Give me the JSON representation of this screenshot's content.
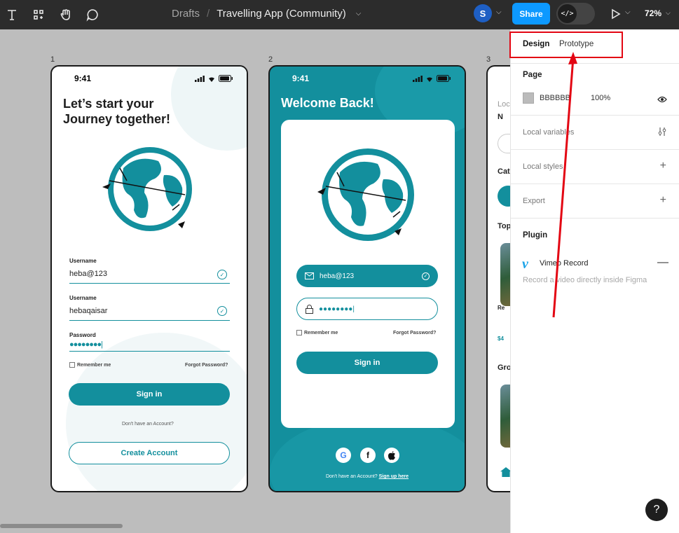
{
  "toolbar": {
    "breadcrumb": {
      "parent": "Drafts",
      "separator": "/",
      "file": "Travelling App (Community)"
    },
    "avatar_letter": "S",
    "share_label": "Share",
    "zoom": "72%",
    "tools": [
      "text-icon",
      "frame-icon",
      "hand-icon",
      "comment-icon"
    ]
  },
  "frames": [
    {
      "number": "1",
      "time": "9:41"
    },
    {
      "number": "2",
      "time": "9:41"
    },
    {
      "number": "3"
    }
  ],
  "screen1": {
    "heading": "Let’s start your Journey together!",
    "field1_label": "Username",
    "field1_value": "heba@123",
    "field2_label": "Username",
    "field2_value": "hebaqaisar",
    "password_label": "Password",
    "password_value": "●●●●●●●●|",
    "remember": "Remember me",
    "forgot": "Forgot Password?",
    "sign_in": "Sign in",
    "no_account": "Don't have an Account?",
    "create_account": "Create Account"
  },
  "screen2": {
    "heading": "Welcome Back!",
    "email_value": "heba@123",
    "password_value": "●●●●●●●●|",
    "remember": "Remember me",
    "forgot": "Forgot Password?",
    "sign_in": "Sign in",
    "social": [
      "G",
      "f",
      ""
    ],
    "footer_text": "Don't have an Account?",
    "footer_link": "Sign up here"
  },
  "screen3": {
    "partial_labels": [
      "Loc",
      "N",
      "Cat",
      "Top",
      "Re",
      "$4",
      "Gro"
    ]
  },
  "panel": {
    "tab_design": "Design",
    "tab_prototype": "Prototype",
    "page_title": "Page",
    "page_color": "BBBBBB",
    "page_opacity": "100%",
    "local_variables": "Local variables",
    "local_styles": "Local styles",
    "export": "Export",
    "plugin_title": "Plugin",
    "plugin_name": "Vimeo Record",
    "plugin_desc": "Record a video directly inside Figma"
  },
  "help": "?",
  "colors": {
    "accent": "#138f9d",
    "share": "#0d99ff",
    "annotation": "#e30613"
  }
}
